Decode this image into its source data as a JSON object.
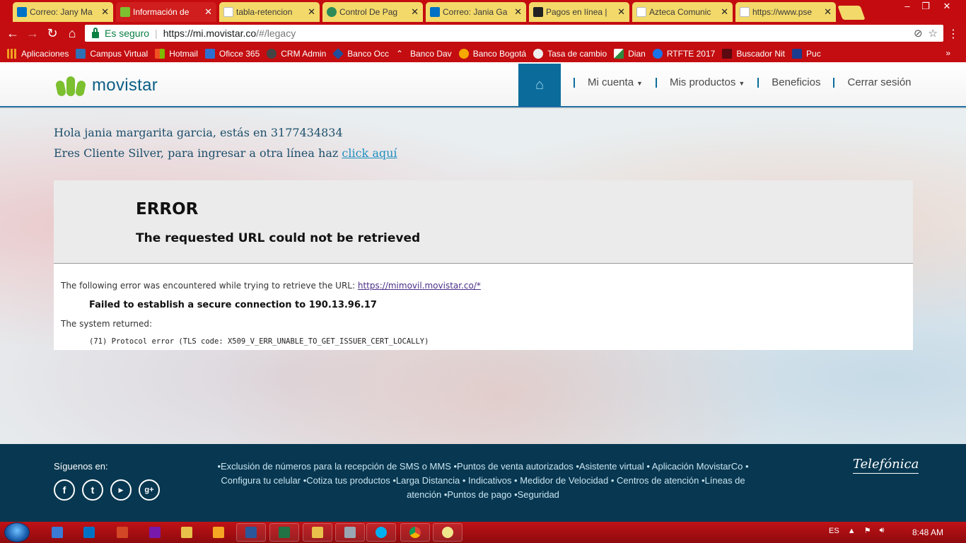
{
  "browser": {
    "tabs": [
      {
        "label": "Correo: Jany Ma",
        "favicon_color": "#0072c6",
        "active": false
      },
      {
        "label": "Información de",
        "favicon_color": "#7cbf2f",
        "active": true
      },
      {
        "label": "tabla-retencion",
        "favicon_color": "#ffffff",
        "active": false
      },
      {
        "label": "Control De Pag",
        "favicon_color": "#2e8b57",
        "active": false
      },
      {
        "label": "Correo: Jania Ga",
        "favicon_color": "#0072c6",
        "active": false
      },
      {
        "label": "Pagos en línea |",
        "favicon_color": "#222222",
        "active": false
      },
      {
        "label": "Azteca Comunic",
        "favicon_color": "#ffffff",
        "active": false
      },
      {
        "label": "https://www.pse",
        "favicon_color": "#ffffff",
        "active": false
      }
    ],
    "omnibox": {
      "secure_label": "Es seguro",
      "url_host": "https://mi.movistar.co",
      "url_path": "/#/legacy"
    },
    "bookmarks": [
      {
        "label": "Aplicaciones",
        "color": "#f0a020"
      },
      {
        "label": "Campus Virtual",
        "color": "#2f6fb3"
      },
      {
        "label": "Hotmail",
        "color": "#f25022"
      },
      {
        "label": "Oficce 365",
        "color": "#eb3c00"
      },
      {
        "label": "CRM Admin",
        "color": "#444444"
      },
      {
        "label": "Banco Occ",
        "color": "#1f4e9c"
      },
      {
        "label": "Banco Dav",
        "color": "#c30d10"
      },
      {
        "label": "Banco Bogotá",
        "color": "#f6a800"
      },
      {
        "label": "Tasa de cambio",
        "color": "#222222"
      },
      {
        "label": "Dian",
        "color": "#2d8a3e"
      },
      {
        "label": "RTFTE 2017",
        "color": "#1a73e8"
      },
      {
        "label": "Buscador Nit",
        "color": "#5a0a10"
      },
      {
        "label": "Puc",
        "color": "#1d3c8f"
      }
    ],
    "bookmarks_more": "»"
  },
  "site": {
    "logo_text": "movistar",
    "nav": {
      "mi_cuenta": "Mi cuenta",
      "mis_productos": "Mis productos",
      "beneficios": "Beneficios",
      "cerrar_sesion": "Cerrar sesión"
    },
    "greeting": {
      "line1": "Hola jania margarita garcia, estás en 3177434834",
      "line2_prefix": "Eres Cliente Silver, para ingresar a otra línea haz ",
      "line2_link": "click aquí"
    },
    "error": {
      "title": "ERROR",
      "subtitle": "The requested URL could not be retrieved",
      "line1_prefix": "The following error was encountered while trying to retrieve the URL: ",
      "line1_link": "https://mimovil.movistar.co/*",
      "line2": "Failed to establish a secure connection to 190.13.96.17",
      "line3": "The system returned:",
      "line4": "(71) Protocol error (TLS code: X509_V_ERR_UNABLE_TO_GET_ISSUER_CERT_LOCALLY)"
    },
    "footer": {
      "follow_label": "Síguenos en:",
      "links_text": "•Exclusión de números para la recepción de SMS o MMS •Puntos de venta autorizados •Asistente virtual • Aplicación MovistarCo • Configura tu celular •Cotiza tus productos •Larga Distancia • Indicativos • Medidor de Velocidad • Centros de atención •Líneas de atención •Puntos de pago •Seguridad",
      "brand": "Telefónica"
    }
  },
  "taskbar": {
    "language": "ES",
    "time": "8:48 AM"
  }
}
